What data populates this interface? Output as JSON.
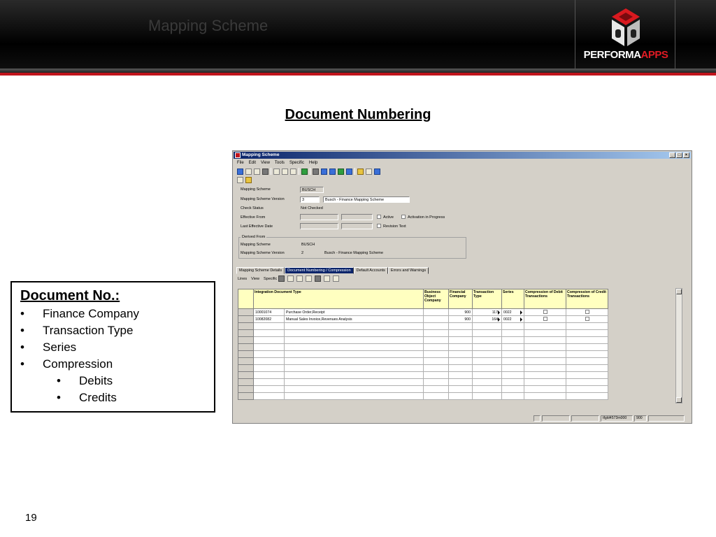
{
  "slide": {
    "header_title": "Mapping Scheme",
    "logo": {
      "brand": "PERFORMA",
      "accent": "APPS"
    },
    "title": "Document Numbering",
    "page_number": "19",
    "doc_box": {
      "title": "Document No.:",
      "items": [
        "Finance Company",
        "Transaction Type",
        "Series",
        "Compression"
      ],
      "sub_items": [
        "Debits",
        "Credits"
      ]
    }
  },
  "colors": {
    "accent_red": "#c0141c",
    "titlebar_blue": "#0a246a",
    "header_yellow": "#ffffc0"
  },
  "app": {
    "window_title": "Mapping Scheme",
    "window_buttons": [
      "_",
      "□",
      "×"
    ],
    "menu": [
      "File",
      "Edit",
      "View",
      "Tools",
      "Specific",
      "Help"
    ],
    "toolbar1_icons": [
      "save-icon",
      "save-disk-icon",
      "copy-icon",
      "print-icon",
      "new-icon",
      "duplicate-icon",
      "paste-icon",
      "find-icon",
      "first-record-icon",
      "previous-record-icon",
      "next-record-icon",
      "last-record-icon",
      "refresh-icon",
      "close-icon",
      "help-icon"
    ],
    "toolbar2_icons": [
      "text-icon",
      "report-icon"
    ],
    "fields": {
      "mapping_scheme_label": "Mapping Scheme",
      "mapping_scheme_value": "BUSCH",
      "version_label": "Mapping Scheme Version",
      "version_value": "3",
      "version_desc": "Busch - Finance Mapping Scheme",
      "check_status_label": "Check Status",
      "check_status_value": "Not Checked",
      "effective_from_label": "Effective From",
      "last_effective_label": "Last Effective Date",
      "active_label": "Active",
      "activation_label": "Activation in Progress",
      "revision_label": "Revision Text"
    },
    "derived_from": {
      "group_label": "Derived From",
      "scheme_label": "Mapping Scheme",
      "scheme_value": "BUSCH",
      "version_label": "Mapping Scheme Version",
      "version_value": "2",
      "version_desc": "Busch - Finance Mapping Scheme"
    },
    "tabs": [
      "Mapping Scheme Details",
      "Document Numbering / Compression",
      "Default Accounts",
      "Errors and Warnings"
    ],
    "sub_menu": [
      "Lines",
      "View",
      "Specific"
    ],
    "grid": {
      "headers": [
        "Integration Document Type",
        "Business Object Company",
        "Financial Company",
        "Transaction Type",
        "Series",
        "Compression of Debit Transactions",
        "Compression of Credit Transactions"
      ],
      "rows": [
        {
          "code": "10001074",
          "desc": "Purchase Order,Receipt",
          "boc": "",
          "fin_company": "900",
          "trans_type": "117",
          "series": "0022"
        },
        {
          "code": "10082082",
          "desc": "Manual Sales Invoice,Revenues Analysis",
          "boc": "",
          "fin_company": "900",
          "trans_type": "164",
          "series": "0022"
        }
      ]
    },
    "status_bar": [
      "",
      "",
      "",
      "tfgld4573m000",
      "900",
      ""
    ]
  }
}
